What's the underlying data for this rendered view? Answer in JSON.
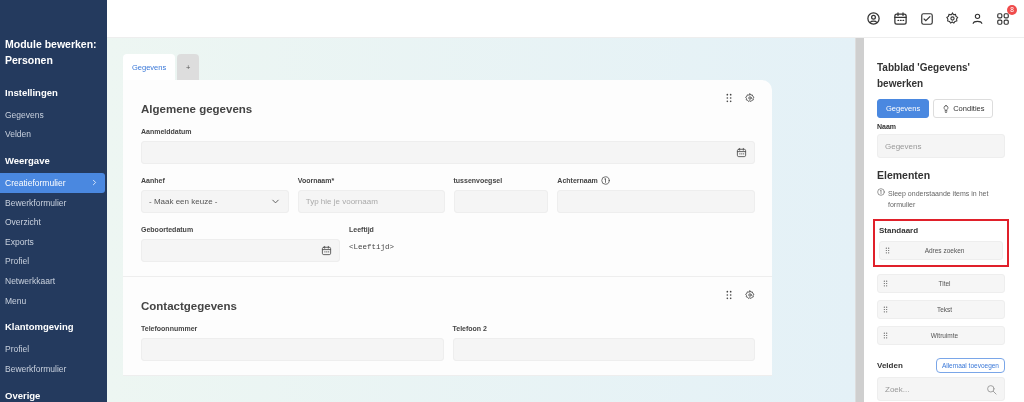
{
  "sidebar": {
    "title": "Module bewerken: Personen",
    "sections": [
      {
        "heading": "Instellingen",
        "items": [
          {
            "label": "Gegevens",
            "selected": false
          },
          {
            "label": "Velden",
            "selected": false
          }
        ]
      },
      {
        "heading": "Weergave",
        "items": [
          {
            "label": "Creatieformulier",
            "selected": true
          },
          {
            "label": "Bewerkformulier",
            "selected": false
          },
          {
            "label": "Overzicht",
            "selected": false
          },
          {
            "label": "Exports",
            "selected": false
          },
          {
            "label": "Profiel",
            "selected": false
          },
          {
            "label": "Netwerkkaart",
            "selected": false
          },
          {
            "label": "Menu",
            "selected": false
          }
        ]
      },
      {
        "heading": "Klantomgeving",
        "items": [
          {
            "label": "Profiel",
            "selected": false
          },
          {
            "label": "Bewerkformulier",
            "selected": false
          }
        ]
      },
      {
        "heading": "Overige"
      }
    ]
  },
  "topbar": {
    "badge": "8"
  },
  "tabs": [
    {
      "label": "Gegevens",
      "selected": true,
      "kind": "tab"
    },
    {
      "label": "+",
      "selected": false,
      "kind": "add"
    }
  ],
  "sections": [
    {
      "title": "Algemene gegevens",
      "rows": [
        [
          {
            "label": "Aanmelddatum",
            "kind": "date"
          }
        ],
        [
          {
            "label": "Aanhef",
            "kind": "select",
            "value": "- Maak een keuze -"
          },
          {
            "label": "Voornaam*",
            "kind": "text",
            "placeholder": "Typ hie je voornaam"
          },
          {
            "label": "tussenvoegsel",
            "kind": "text"
          },
          {
            "label": "Achternaam",
            "kind": "text",
            "info": true
          }
        ],
        [
          {
            "label": "Geboortedatum",
            "kind": "date"
          },
          {
            "label": "Leeftijd",
            "kind": "static",
            "value": "<Leeftijd>"
          }
        ]
      ]
    },
    {
      "title": "Contactgegevens",
      "rows": [
        [
          {
            "label": "Telefoonnummer",
            "kind": "text"
          },
          {
            "label": "Telefoon 2",
            "kind": "text"
          }
        ]
      ]
    }
  ],
  "panel": {
    "title": "Tabblad 'Gegevens' bewerken",
    "toggles": [
      {
        "label": "Gegevens",
        "selected": true
      },
      {
        "label": "Condities",
        "selected": false
      }
    ],
    "name_label": "Naam",
    "name_value": "Gegevens",
    "elements_heading": "Elementen",
    "hint": "Sleep onderstaande items in het formulier",
    "standard": {
      "heading": "Standaard",
      "highlighted": true,
      "items": [
        "Adres zoeken",
        "Titel",
        "Tekst",
        "Witruimte"
      ]
    },
    "fields_heading": "Velden",
    "add_all": "Allemaal toevoegen",
    "search_placeholder": "Zoek..."
  }
}
